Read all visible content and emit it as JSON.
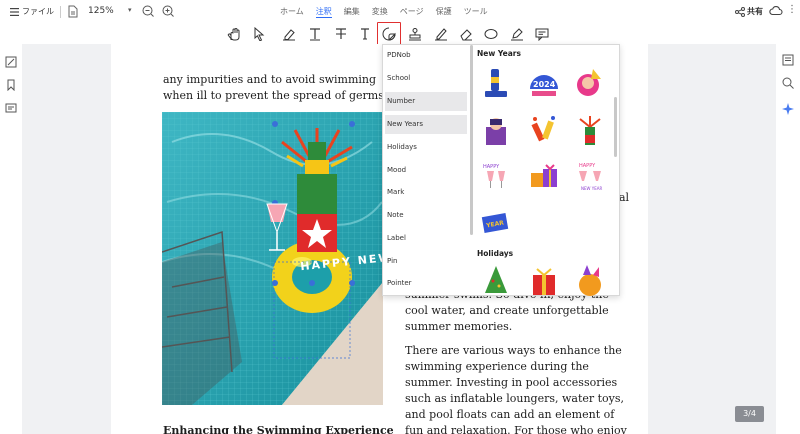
{
  "topbar": {
    "file_label": "ファイル",
    "zoom": "125%",
    "tabs": [
      "ホーム",
      "注釈",
      "編集",
      "変換",
      "ページ",
      "保護",
      "ツール"
    ],
    "active_tab": "注釈",
    "share_label": "共有"
  },
  "document": {
    "para1": "any impurities and to avoid swimming when ill to prevent the spread of germs.",
    "para2": "summer swims. So dive in, enjoy the cool water, and create unforgettable summer memories.",
    "para3": "There are various ways to enhance the swimming experience during the summer. Investing in pool accessories such as inflatable loungers, water toys, and pool floats can add an element of fun and relaxation. For those who enjoy swimming as",
    "heading": "Enhancing the Swimming Experience",
    "cut_letter": "al"
  },
  "sticker_panel": {
    "categories": [
      "PDNob",
      "School",
      "Number",
      "New Years",
      "Holidays",
      "Mood",
      "Mark",
      "Note",
      "Label",
      "Pin",
      "Pointer"
    ],
    "selected_category": "New Years",
    "sections": [
      {
        "title": "New Years",
        "stickers": [
          "new-year-bottle-sticker",
          "2024-sticker",
          "party-girl-sticker",
          "champagne-girl-sticker",
          "firecrackers-sticker",
          "champagne-bottle-sticker",
          "happy-new-year-glasses-sticker",
          "gift-boxes-sticker",
          "happy-new-year-toast-sticker",
          "new-year-sign-sticker"
        ]
      },
      {
        "title": "Holidays",
        "stickers": [
          "christmas-tree-sticker",
          "gift-box-sticker",
          "party-cat-sticker"
        ]
      }
    ]
  },
  "overlay_sticker_text": "HAPPY NEW",
  "page_indicator": "3/4",
  "colors": {
    "accent": "#2d6cf6",
    "selected_tool_border": "#e03030"
  }
}
